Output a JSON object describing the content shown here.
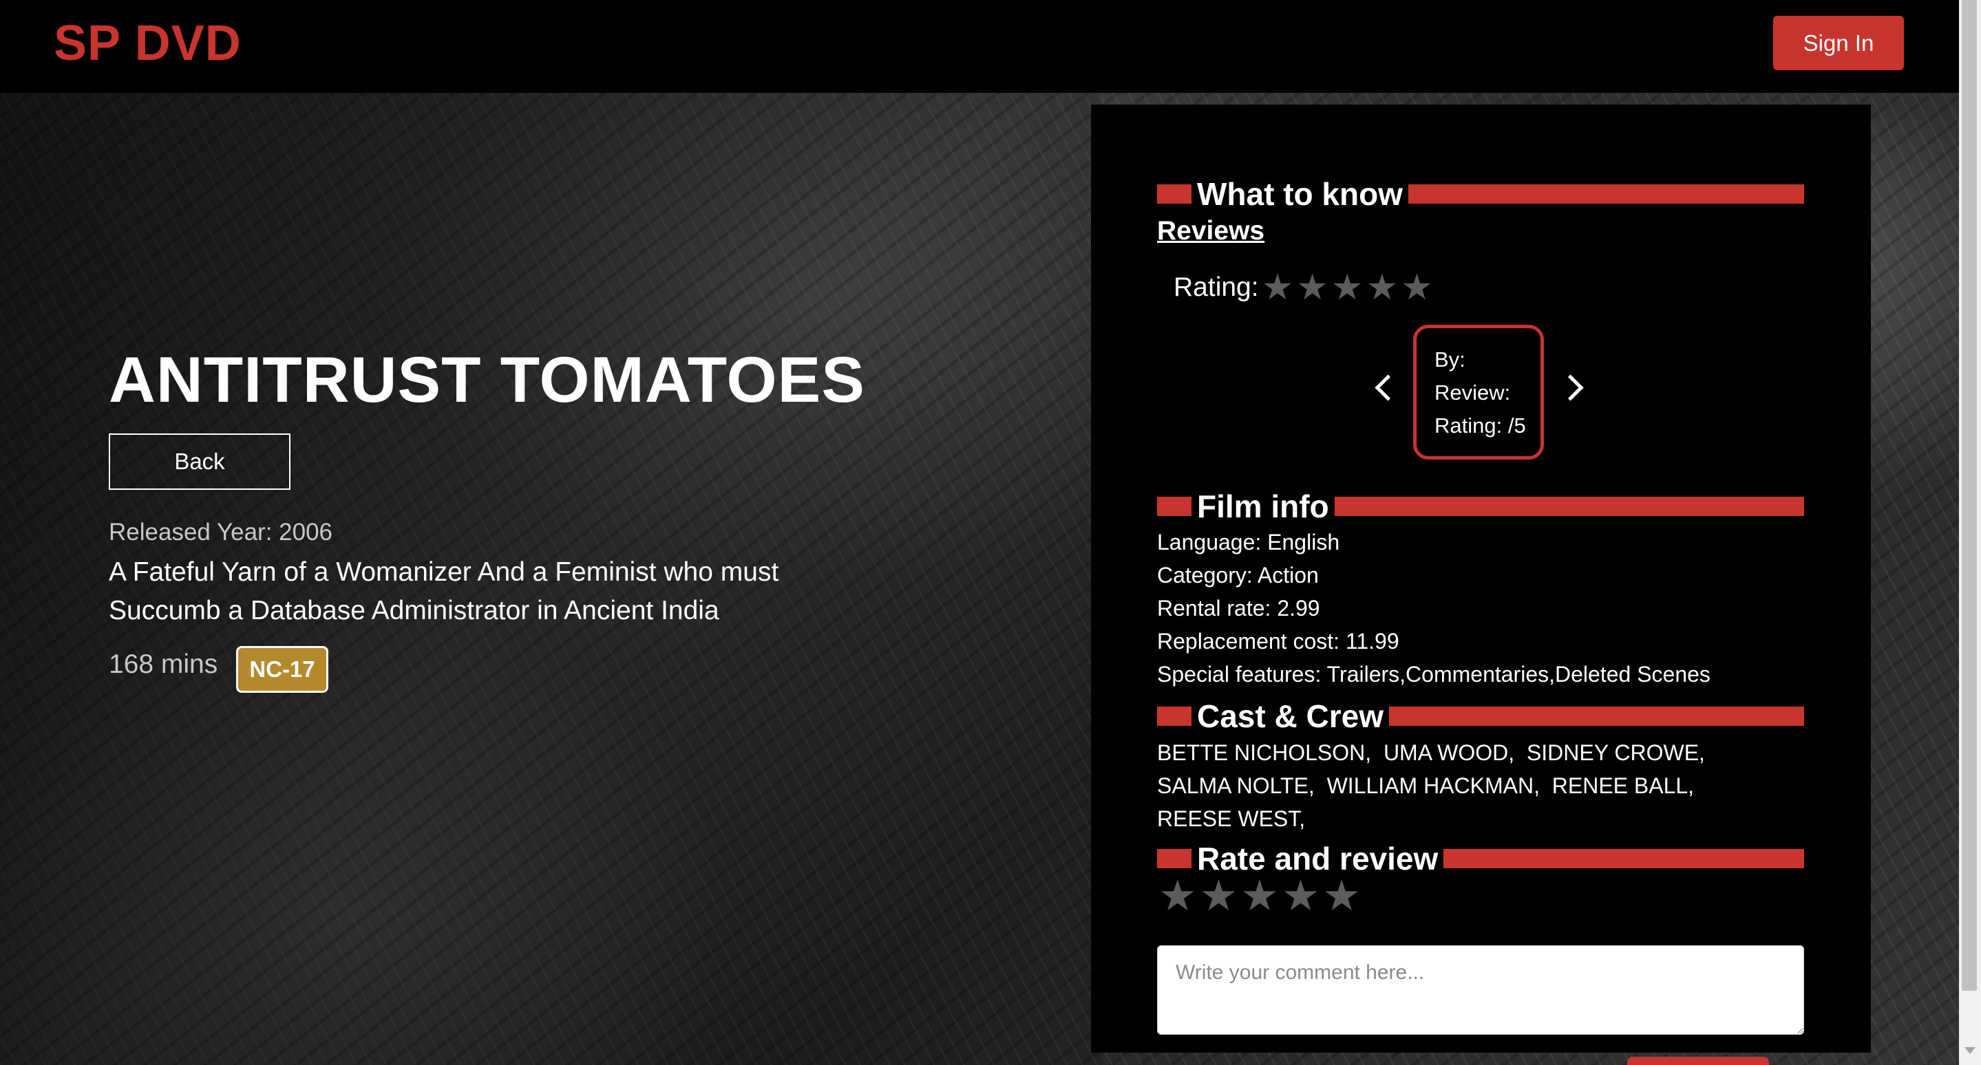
{
  "navbar": {
    "brand": "SP DVD",
    "signin_label": "Sign In"
  },
  "film": {
    "title": "ANTITRUST TOMATOES",
    "back_label": "Back",
    "released": "Released Year: 2006",
    "description": "A Fateful Yarn of a Womanizer And a Feminist who must Succumb a Database Administrator in Ancient India",
    "duration": "168 mins",
    "rating_badge": "NC-17"
  },
  "panel": {
    "what_to_know": "What to know",
    "reviews_link": "Reviews",
    "rating_label": "Rating:",
    "average_rating_stars": 0,
    "review_card": {
      "by": "By:",
      "review": "Review:",
      "rating": "Rating: /5"
    },
    "film_info_heading": "Film info",
    "language": "Language: English",
    "category": "Category: Action",
    "rental_rate": "Rental rate: 2.99",
    "replacement_cost": "Replacement cost: 11.99",
    "special_features": "Special features: Trailers,Commentaries,Deleted Scenes",
    "cast_heading": "Cast & Crew",
    "cast": [
      "BETTE NICHOLSON,",
      "UMA WOOD,",
      "SIDNEY CROWE,",
      "SALMA NOLTE,",
      "WILLIAM HACKMAN,",
      "RENEE BALL,",
      "REESE WEST,"
    ],
    "rate_review_heading": "Rate and review",
    "user_rating_stars": 0,
    "comment_placeholder": "Write your comment here..."
  },
  "colors": {
    "accent": "#c8342e",
    "badge": "#b48a2c",
    "star_inactive": "#5c5c5c"
  },
  "icons": [
    "star-icon",
    "chevron-left-icon",
    "chevron-right-icon"
  ]
}
